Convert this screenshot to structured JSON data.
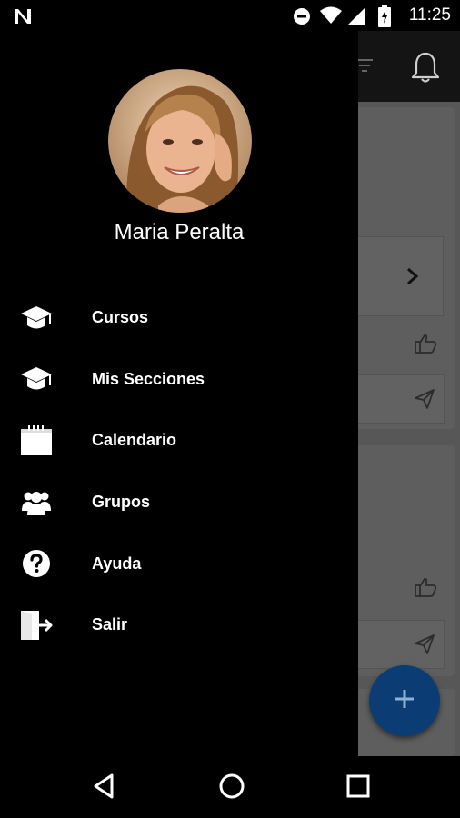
{
  "status_bar": {
    "time": "11:25"
  },
  "drawer": {
    "user_name": "Maria Peralta",
    "menu": [
      {
        "label": "Cursos",
        "icon": "graduation-cap-icon"
      },
      {
        "label": "Mis Secciones",
        "icon": "graduation-cap-icon"
      },
      {
        "label": "Calendario",
        "icon": "calendar-icon"
      },
      {
        "label": "Grupos",
        "icon": "group-icon"
      },
      {
        "label": "Ayuda",
        "icon": "help-icon"
      },
      {
        "label": "Salir",
        "icon": "logout-icon"
      }
    ]
  },
  "colors": {
    "fab": "#0b3d74",
    "drawer_bg": "#000000",
    "scrim_content": "#575757"
  }
}
